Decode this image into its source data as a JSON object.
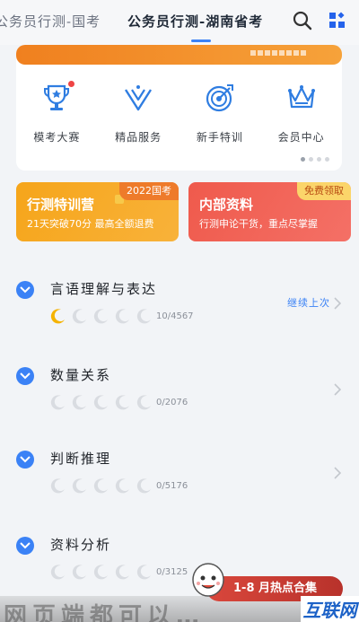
{
  "tabs": {
    "inactive_label": "公务员行测-国考",
    "active_label": "公务员行测-湖南省考"
  },
  "top_icons": [
    "search-icon",
    "grid-menu-icon"
  ],
  "menu": [
    {
      "label": "模考大赛",
      "icon": "trophy-icon",
      "badge": true
    },
    {
      "label": "精品服务",
      "icon": "crown-v-icon",
      "badge": false
    },
    {
      "label": "新手特训",
      "icon": "target-icon",
      "badge": false
    },
    {
      "label": "会员中心",
      "icon": "crown-icon",
      "badge": false
    }
  ],
  "promo": {
    "left": {
      "title": "行测特训营",
      "subtitle": "21天突破70分 最高全额退费",
      "tag": "2022国考"
    },
    "right": {
      "title": "内部资料",
      "subtitle": "行测申论干货，重点尽掌握",
      "tag": "免费领取"
    }
  },
  "sections": [
    {
      "title": "言语理解与表达",
      "progress": "10/4567",
      "continue": "继续上次",
      "moons_filled": 1
    },
    {
      "title": "数量关系",
      "progress": "0/2076",
      "continue": "",
      "moons_filled": 0
    },
    {
      "title": "判断推理",
      "progress": "0/5176",
      "continue": "",
      "moons_filled": 0
    },
    {
      "title": "资料分析",
      "progress": "0/3125",
      "continue": "",
      "moons_filled": 0
    }
  ],
  "hot_banner": "1-8 月热点合集",
  "watermark": "互联网",
  "bottom_text": "网页端都可以…",
  "colors": {
    "accent": "#3b82f6",
    "orange": "#f6a51a",
    "red": "#ef5a4c"
  }
}
